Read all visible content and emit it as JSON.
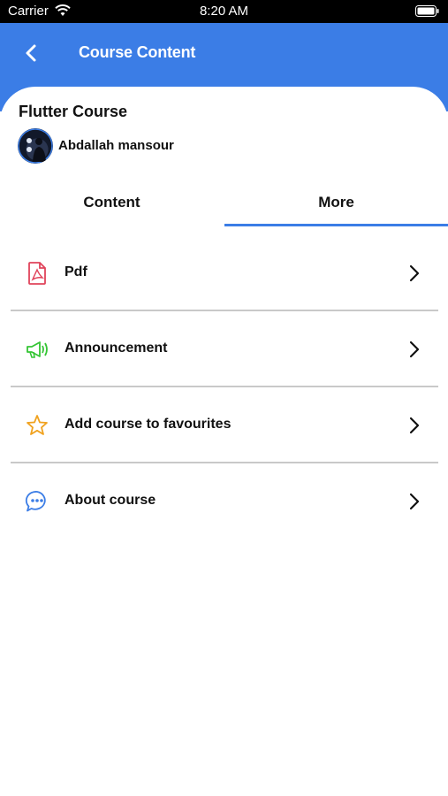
{
  "status_bar": {
    "carrier": "Carrier",
    "time": "8:20 AM"
  },
  "app_bar": {
    "title": "Course Content"
  },
  "course": {
    "title": "Flutter Course",
    "instructor": "Abdallah mansour"
  },
  "tabs": [
    {
      "label": "Content"
    },
    {
      "label": "More",
      "selected": true
    }
  ],
  "menu": [
    {
      "label": "Pdf",
      "icon": "pdf-icon",
      "color": "#e0445b"
    },
    {
      "label": "Announcement",
      "icon": "megaphone-icon",
      "color": "#35c535"
    },
    {
      "label": "Add course to favourites",
      "icon": "star-icon",
      "color": "#f0a21f"
    },
    {
      "label": "About course",
      "icon": "chat-bubble-icon",
      "color": "#3b7de6"
    }
  ],
  "colors": {
    "primary": "#3b7de6",
    "divider": "#c9c9c9"
  }
}
